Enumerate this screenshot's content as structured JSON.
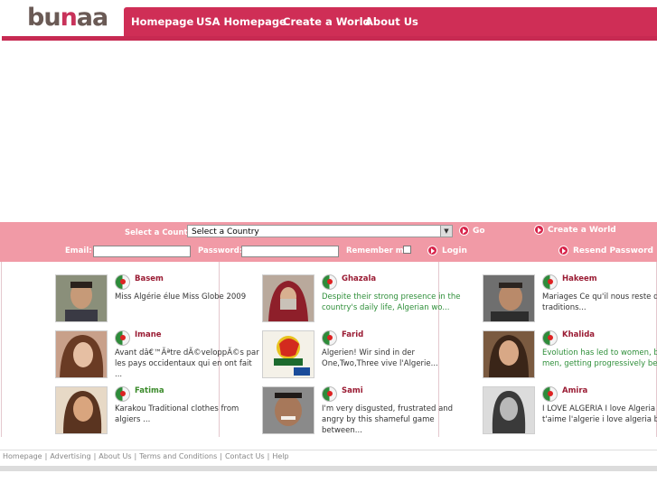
{
  "header": {
    "logo_text_a": "bu",
    "logo_text_b": "n",
    "logo_text_c": "aa",
    "nav": [
      "Homepage",
      "USA Homepage",
      "Create a World",
      "About Us"
    ]
  },
  "filter": {
    "country_label": "Select a Country:",
    "country_value": "Select a Country",
    "go_label": "Go",
    "create_world_label": "Create a World",
    "email_label": "Email:",
    "password_label": "Password:",
    "remember_label": "Remember me",
    "login_label": "Login",
    "resend_label": "Resend Password"
  },
  "members": [
    {
      "name": "Basem",
      "desc": "Miss Algérie élue Miss Globe 2009",
      "name_green": false,
      "desc_green": false
    },
    {
      "name": "Ghazala",
      "desc": "Despite their strong presence in the country's daily life, Algerian wo...",
      "name_green": false,
      "desc_green": true
    },
    {
      "name": "Hakeem",
      "desc": "Mariages Ce qu'il nous reste des traditions...",
      "name_green": false,
      "desc_green": false
    },
    {
      "name": "Imane",
      "desc": "Avant dâ€™Ãªtre dÃ©veloppÃ©s par les pays occidentaux qui en ont fait ...",
      "name_green": false,
      "desc_green": false
    },
    {
      "name": "Farid",
      "desc": "Algerien! Wir sind in der One,Two,Three vive l'Algerie...",
      "name_green": false,
      "desc_green": false
    },
    {
      "name": "Khalida",
      "desc": "Evolution has led to women, but not men, getting progressively beautif...",
      "name_green": false,
      "desc_green": true
    },
    {
      "name": "Fatima",
      "desc": "Karakou Traditional clothes from algiers ...",
      "name_green": true,
      "desc_green": false
    },
    {
      "name": "Sami",
      "desc": "I'm very disgusted, frustrated and angry by this shameful game between...",
      "name_green": false,
      "desc_green": false
    },
    {
      "name": "Amira",
      "desc": "I LOVE ALGERIA I love Algeria je t'aime l'algerie i love algeria belle ...",
      "name_green": false,
      "desc_green": false
    }
  ],
  "footer": [
    "Homepage",
    "Advertising",
    "About Us",
    "Terms and Conditions",
    "Contact Us",
    "Help"
  ],
  "colors": {
    "brand": "#cf2e56",
    "filter_bar": "#f19aa6"
  }
}
